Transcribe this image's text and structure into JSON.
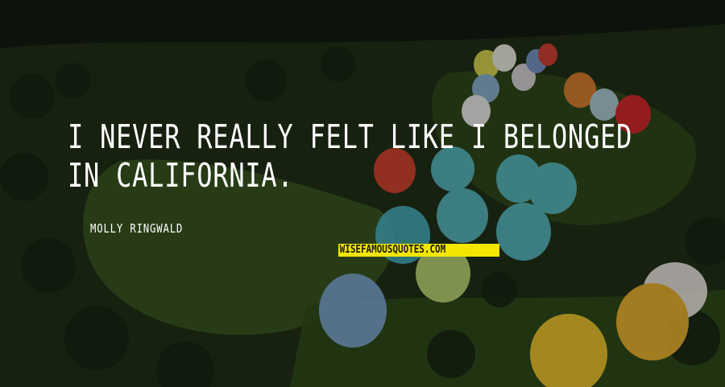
{
  "quote": {
    "text": "I NEVER REALLY FELT LIKE I BELONGED IN CALIFORNIA."
  },
  "author": {
    "name": "MOLLY RINGWALD"
  },
  "watermark": {
    "text": "WISEFAMOUSQUOTES.COM",
    "background_color": "#f3e600"
  },
  "background": {
    "description_icon": "hot-air-balloon-field-photo",
    "colors": {
      "overlay": "#000000",
      "grass": "#2e4a18",
      "trees": "#1b2a12"
    }
  }
}
